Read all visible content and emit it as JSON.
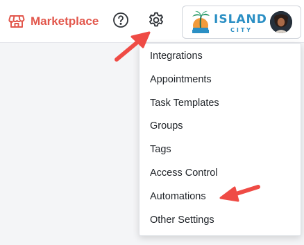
{
  "header": {
    "marketplace_label": "Marketplace",
    "brand": {
      "name": "ISLAND",
      "sub": "CITY"
    }
  },
  "icons": {
    "marketplace": "storefront-icon",
    "help": "question-circle-icon",
    "settings": "gear-icon"
  },
  "settings_menu": {
    "items": [
      {
        "label": "Integrations"
      },
      {
        "label": "Appointments"
      },
      {
        "label": "Task Templates"
      },
      {
        "label": "Groups"
      },
      {
        "label": "Tags"
      },
      {
        "label": "Access Control"
      },
      {
        "label": "Automations"
      },
      {
        "label": "Other Settings"
      }
    ]
  },
  "colors": {
    "marketplace_accent": "#e2574c",
    "brand_blue": "#2b8fc4",
    "brand_orange": "#f29a3a",
    "annotation_arrow": "#ef4b45"
  },
  "annotations": [
    {
      "name": "arrow-to-settings",
      "target": "gear-icon"
    },
    {
      "name": "arrow-to-automations",
      "target": "Automations"
    }
  ]
}
